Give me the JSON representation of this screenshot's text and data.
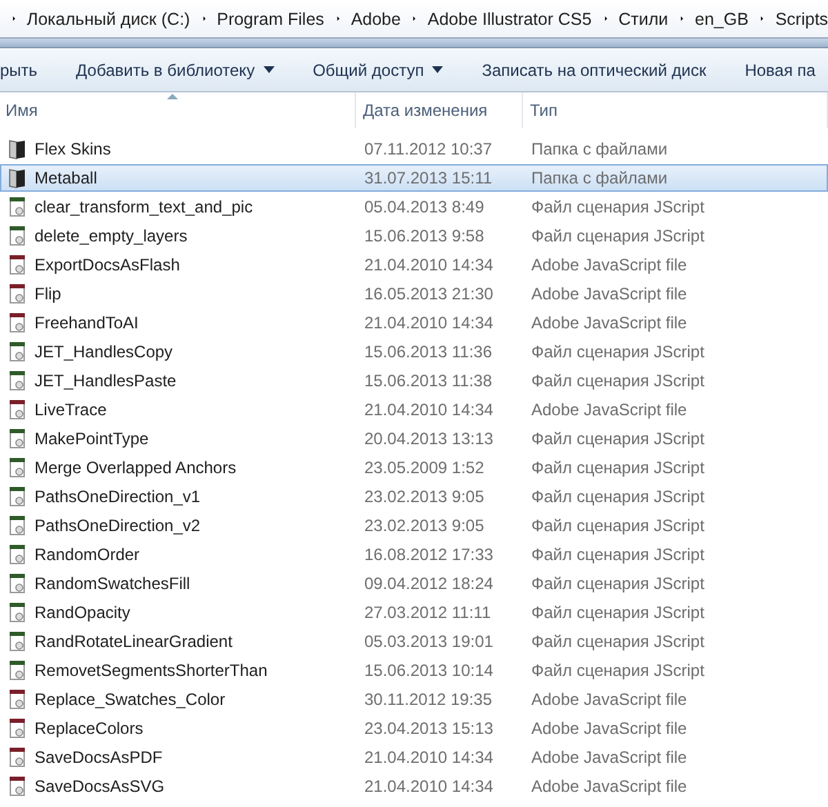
{
  "breadcrumb": [
    "Локальный диск (C:)",
    "Program Files",
    "Adobe",
    "Adobe Illustrator CS5",
    "Стили",
    "en_GB",
    "Scripts"
  ],
  "toolbar": [
    {
      "label": "рыть",
      "dropdown": false
    },
    {
      "label": "Добавить в библиотеку",
      "dropdown": true
    },
    {
      "label": "Общий доступ",
      "dropdown": true
    },
    {
      "label": "Записать на оптический диск",
      "dropdown": false
    },
    {
      "label": "Новая па",
      "dropdown": false
    }
  ],
  "columns": [
    "Имя",
    "Дата изменения",
    "Тип"
  ],
  "rows": [
    {
      "name": "Flex Skins",
      "date": "07.11.2012 10:37",
      "type": "Папка с файлами",
      "kind": "folder",
      "selected": false
    },
    {
      "name": "Metaball",
      "date": "31.07.2013 15:11",
      "type": "Папка с файлами",
      "kind": "folder",
      "selected": true
    },
    {
      "name": "clear_transform_text_and_pic",
      "date": "05.04.2013 8:49",
      "type": "Файл сценария JScript",
      "kind": "jscript",
      "selected": false
    },
    {
      "name": "delete_empty_layers",
      "date": "15.06.2013 9:58",
      "type": "Файл сценария JScript",
      "kind": "jscript",
      "selected": false
    },
    {
      "name": "ExportDocsAsFlash",
      "date": "21.04.2010 14:34",
      "type": "Adobe JavaScript file",
      "kind": "adobe-js",
      "selected": false
    },
    {
      "name": "Flip",
      "date": "16.05.2013 21:30",
      "type": "Adobe JavaScript file",
      "kind": "adobe-js",
      "selected": false
    },
    {
      "name": "FreehandToAI",
      "date": "21.04.2010 14:34",
      "type": "Adobe JavaScript file",
      "kind": "adobe-js",
      "selected": false
    },
    {
      "name": "JET_HandlesCopy",
      "date": "15.06.2013 11:36",
      "type": "Файл сценария JScript",
      "kind": "jscript",
      "selected": false
    },
    {
      "name": "JET_HandlesPaste",
      "date": "15.06.2013 11:38",
      "type": "Файл сценария JScript",
      "kind": "jscript",
      "selected": false
    },
    {
      "name": "LiveTrace",
      "date": "21.04.2010 14:34",
      "type": "Adobe JavaScript file",
      "kind": "adobe-js",
      "selected": false
    },
    {
      "name": "MakePointType",
      "date": "20.04.2013 13:13",
      "type": "Файл сценария JScript",
      "kind": "jscript",
      "selected": false
    },
    {
      "name": "Merge Overlapped Anchors",
      "date": "23.05.2009 1:52",
      "type": "Файл сценария JScript",
      "kind": "jscript",
      "selected": false
    },
    {
      "name": "PathsOneDirection_v1",
      "date": "23.02.2013 9:05",
      "type": "Файл сценария JScript",
      "kind": "jscript",
      "selected": false
    },
    {
      "name": "PathsOneDirection_v2",
      "date": "23.02.2013 9:05",
      "type": "Файл сценария JScript",
      "kind": "jscript",
      "selected": false
    },
    {
      "name": "RandomOrder",
      "date": "16.08.2012 17:33",
      "type": "Файл сценария JScript",
      "kind": "jscript",
      "selected": false
    },
    {
      "name": "RandomSwatchesFill",
      "date": "09.04.2012 18:24",
      "type": "Файл сценария JScript",
      "kind": "jscript",
      "selected": false
    },
    {
      "name": "RandOpacity",
      "date": "27.03.2012 11:11",
      "type": "Файл сценария JScript",
      "kind": "jscript",
      "selected": false
    },
    {
      "name": "RandRotateLinearGradient",
      "date": "05.03.2013 19:01",
      "type": "Файл сценария JScript",
      "kind": "jscript",
      "selected": false
    },
    {
      "name": "RemovetSegmentsShorterThan",
      "date": "15.06.2013 10:14",
      "type": "Файл сценария JScript",
      "kind": "jscript",
      "selected": false
    },
    {
      "name": "Replace_Swatches_Color",
      "date": "30.11.2012 19:35",
      "type": "Adobe JavaScript file",
      "kind": "adobe-js",
      "selected": false
    },
    {
      "name": "ReplaceColors",
      "date": "23.04.2013 15:13",
      "type": "Adobe JavaScript file",
      "kind": "adobe-js",
      "selected": false
    },
    {
      "name": "SaveDocsAsPDF",
      "date": "21.04.2010 14:34",
      "type": "Adobe JavaScript file",
      "kind": "adobe-js",
      "selected": false
    },
    {
      "name": "SaveDocsAsSVG",
      "date": "21.04.2010 14:34",
      "type": "Adobe JavaScript file",
      "kind": "adobe-js",
      "selected": false
    }
  ]
}
